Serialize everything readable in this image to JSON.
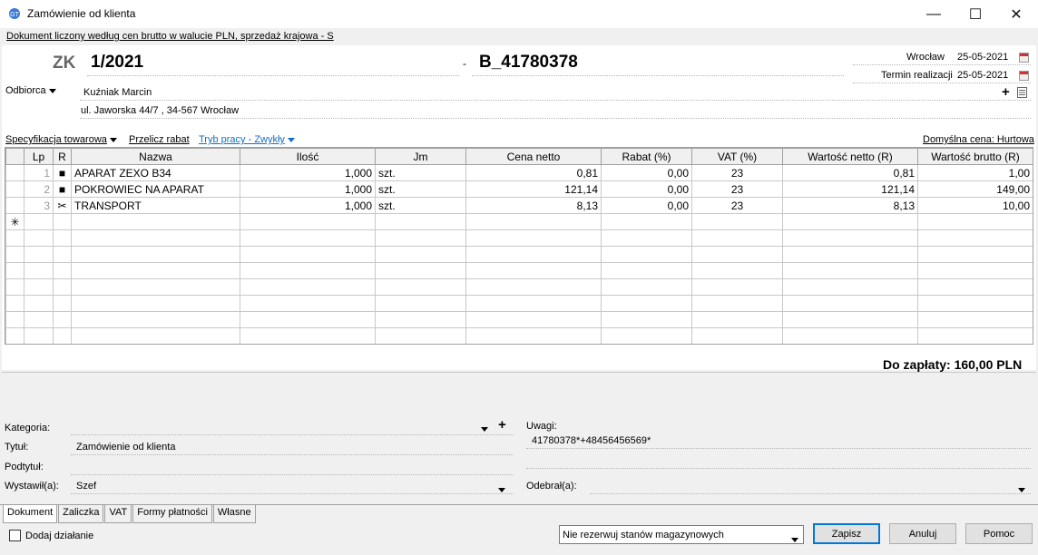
{
  "window": {
    "title": "Zamówienie od klienta",
    "minimize": "—",
    "maximize": "☐",
    "close": "✕"
  },
  "info_bar": "Dokument liczony według cen brutto w walucie PLN, sprzedaż krajowa - S",
  "header": {
    "doc_type": "ZK",
    "doc_number": "1/2021",
    "separator": "-",
    "external_number": "B_41780378",
    "place": "Wrocław",
    "issue_date": "25-05-2021",
    "deadline_label": "Termin realizacji",
    "deadline_date": "25-05-2021"
  },
  "buyer": {
    "label": "Odbiorca",
    "name": "Kuźniak Marcin",
    "address": "ul. Jaworska 44/7 , 34-567 Wrocław"
  },
  "toolbar": {
    "spec": "Specyfikacja towarowa",
    "recalc": "Przelicz rabat",
    "mode": "Tryb pracy - Zwykły",
    "default_price": "Domyślna cena: Hurtowa"
  },
  "table": {
    "columns": [
      "Lp",
      "R",
      "Nazwa",
      "Ilość",
      "Jm",
      "Cena netto",
      "Rabat (%)",
      "VAT (%)",
      "Wartość netto (R)",
      "Wartość brutto (R)"
    ],
    "rows": [
      {
        "lp": "1",
        "r": "■",
        "name": "APARAT ZEXO B34",
        "qty": "1,000",
        "unit": "szt.",
        "price": "0,81",
        "disc": "0,00",
        "vat": "23",
        "net": "0,81",
        "gross": "1,00"
      },
      {
        "lp": "2",
        "r": "■",
        "name": "POKROWIEC NA APARAT",
        "qty": "1,000",
        "unit": "szt.",
        "price": "121,14",
        "disc": "0,00",
        "vat": "23",
        "net": "121,14",
        "gross": "149,00"
      },
      {
        "lp": "3",
        "r": "✂",
        "name": "TRANSPORT",
        "qty": "1,000",
        "unit": "szt.",
        "price": "8,13",
        "disc": "0,00",
        "vat": "23",
        "net": "8,13",
        "gross": "10,00"
      }
    ],
    "new_row_marker": "✳"
  },
  "total": "Do zapłaty: 160,00 PLN",
  "form": {
    "category_label": "Kategoria:",
    "title_label": "Tytuł:",
    "title_value": "Zamówienie od klienta",
    "subtitle_label": "Podtytuł:",
    "issued_label": "Wystawił(a):",
    "issued_value": "Szef",
    "remarks_label": "Uwagi:",
    "remarks_value": "41780378*+48456456569*",
    "received_label": "Odebrał(a):"
  },
  "tabs": [
    "Dokument",
    "Zaliczka",
    "VAT",
    "Formy płatności",
    "Własne"
  ],
  "footer": {
    "add_action": "Dodaj działanie",
    "reserve_option": "Nie rezerwuj stanów magazynowych",
    "save": "Zapisz",
    "cancel": "Anuluj",
    "help": "Pomoc"
  }
}
